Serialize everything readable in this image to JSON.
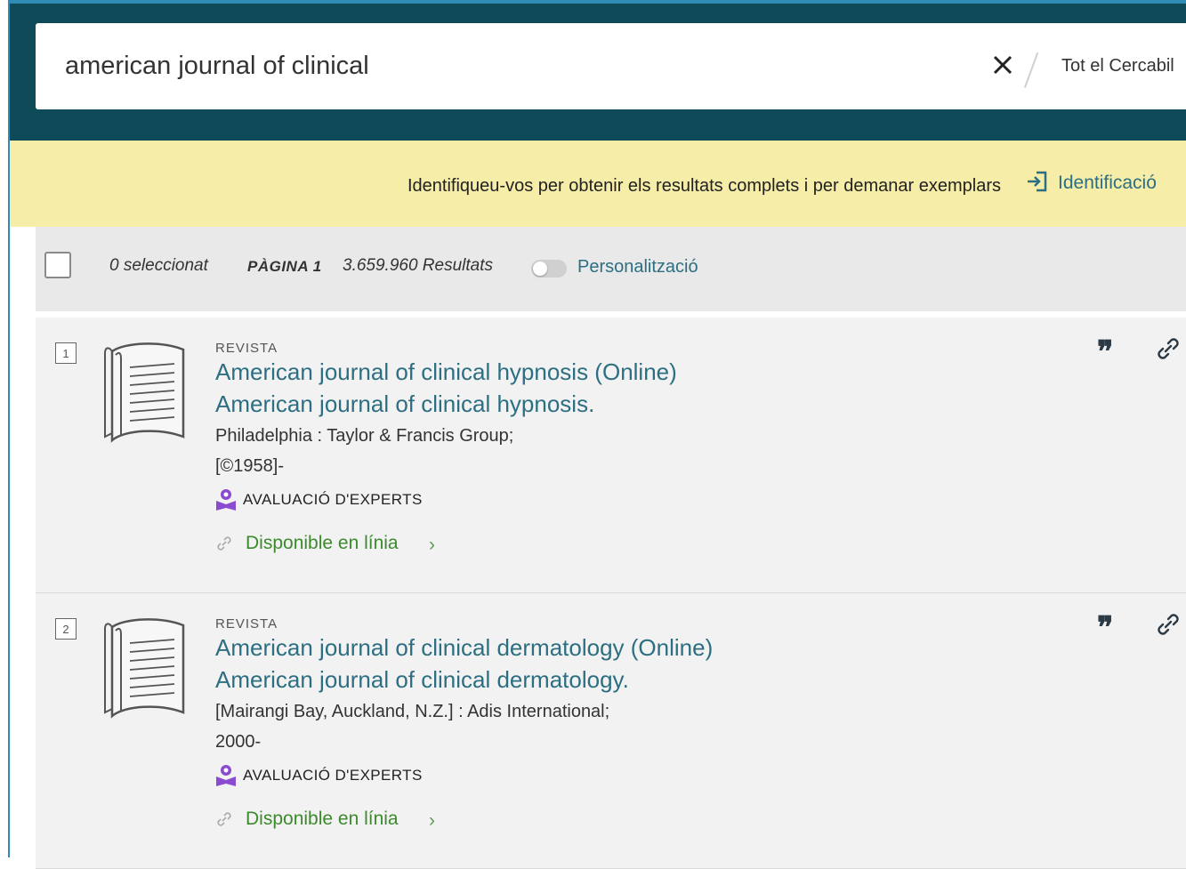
{
  "search": {
    "query": "american journal of clinical",
    "scope": "Tot el Cercabil"
  },
  "login": {
    "message": "Identifiqueu-vos per obtenir els resultats complets i per demanar exemplars",
    "link": "Identificació"
  },
  "toolbar": {
    "selected": "0 seleccionat",
    "page": "PÀGINA 1",
    "results": "3.659.960 Resultats",
    "personalization": "Personalització"
  },
  "results": [
    {
      "index": "1",
      "type": "REVISTA",
      "title": "American journal of clinical hypnosis (Online)",
      "subtitle": "American journal of clinical hypnosis.",
      "publisher": "Philadelphia : Taylor & Francis Group;",
      "date": "[©1958]-",
      "peer_review": "AVALUACIÓ D'EXPERTS",
      "availability": "Disponible en línia",
      "chevron": "›"
    },
    {
      "index": "2",
      "type": "REVISTA",
      "title": "American journal of clinical dermatology (Online)",
      "subtitle": "American journal of clinical dermatology.",
      "publisher": "[Mairangi Bay, Auckland, N.Z.] : Adis International;",
      "date": "2000-",
      "peer_review": "AVALUACIÓ D'EXPERTS",
      "availability": "Disponible en línia",
      "chevron": "›"
    }
  ],
  "icons": {
    "cite": "quote-icon",
    "permalink": "link-icon",
    "clear": "close-icon",
    "login": "sign-in-icon",
    "peer": "peer-review-icon",
    "cite_glyph": "❞"
  },
  "colors": {
    "header": "#0f4a58",
    "login_bar": "#f5eda8",
    "link": "#2d6f82",
    "available": "#3c8a2c",
    "peer": "#8a4bd0"
  }
}
